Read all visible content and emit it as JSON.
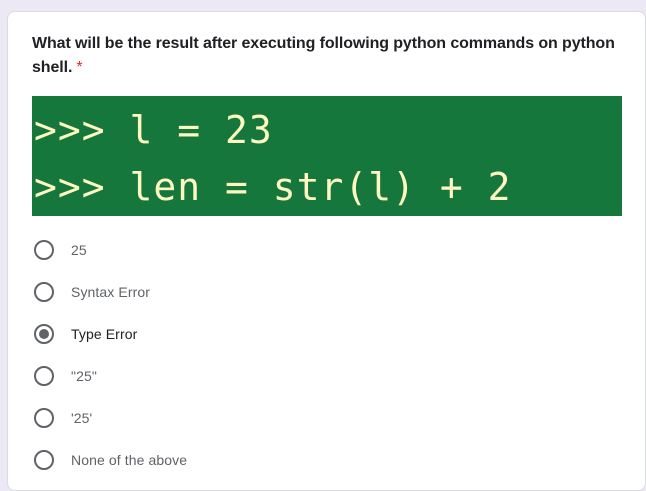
{
  "question": {
    "title": "What will be the result after executing following python commands on python shell.",
    "required_mark": "*"
  },
  "code_image": {
    "lines": [
      ">>> l = 23",
      ">>> len = str(l) + 2"
    ],
    "background_color": "#16773d",
    "text_color": "#fff7c0"
  },
  "options": [
    {
      "label": "25",
      "selected": false
    },
    {
      "label": "Syntax Error",
      "selected": false
    },
    {
      "label": "Type Error",
      "selected": true
    },
    {
      "label": "\"25\"",
      "selected": false
    },
    {
      "label": "'25'",
      "selected": false
    },
    {
      "label": "None of the above",
      "selected": false
    }
  ]
}
